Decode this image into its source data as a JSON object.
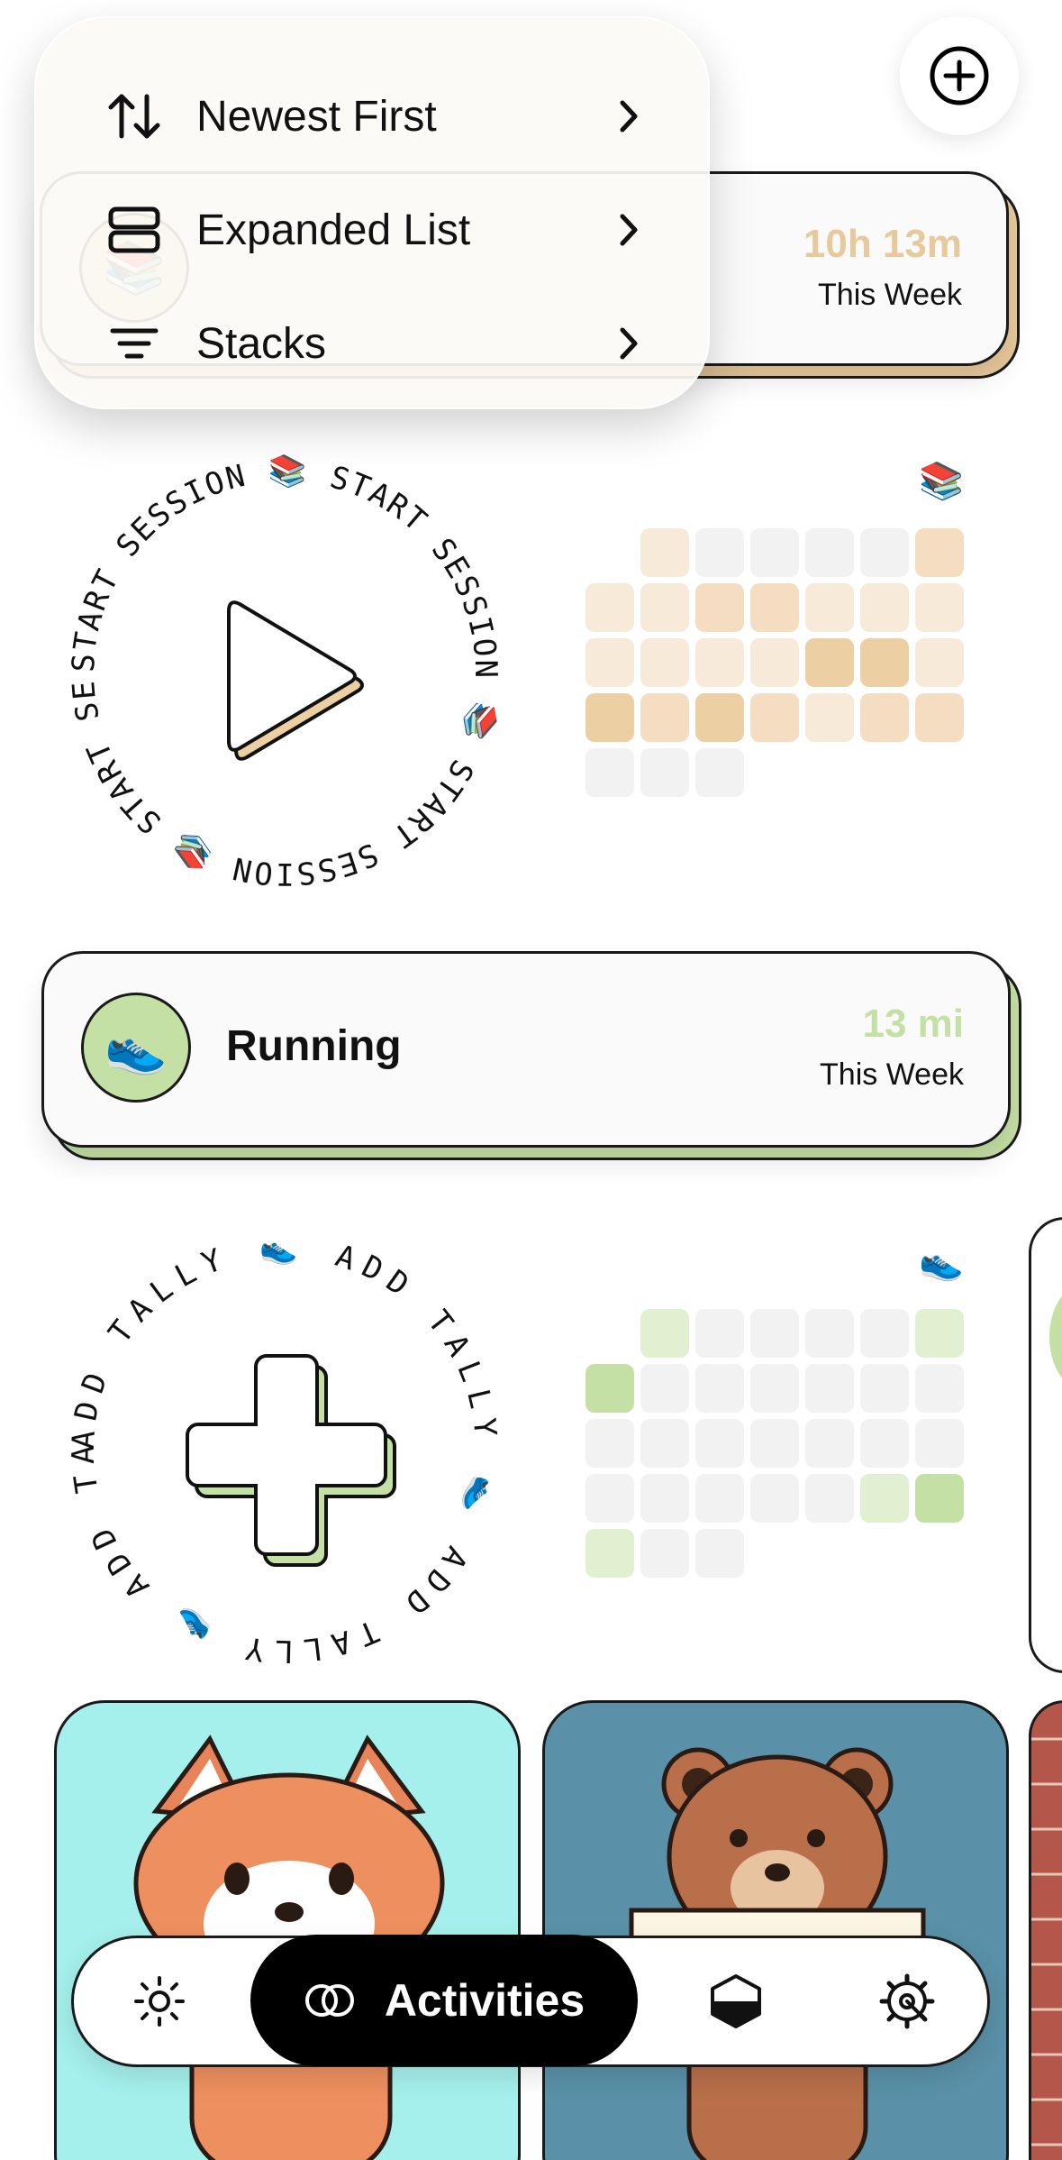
{
  "menu": {
    "items": [
      {
        "label": "Newest First",
        "icon": "sort-arrows-icon"
      },
      {
        "label": "Expanded List",
        "icon": "expanded-list-icon"
      },
      {
        "label": "Stacks",
        "icon": "stacks-icon"
      }
    ]
  },
  "reading_card": {
    "stat": "10h 13m",
    "period": "This Week",
    "icon": "books-icon",
    "accent": "#e8c99b"
  },
  "reading_action": {
    "ring_text": "START SESSION 📚 START SESSION 📚 START SESSION 📚 START SESSION 📚",
    "icon": "play-icon"
  },
  "reading_heatmap": {
    "icon": "books-icon",
    "levels": [
      [
        null,
        1,
        0,
        0,
        0,
        0,
        2
      ],
      [
        1,
        1,
        2,
        2,
        1,
        1,
        1
      ],
      [
        1,
        1,
        1,
        1,
        3,
        3,
        1
      ],
      [
        3,
        2,
        3,
        2,
        1,
        2,
        2
      ],
      [
        0,
        0,
        0,
        null,
        null,
        null,
        null
      ]
    ],
    "colors": [
      "#f2f2f2",
      "#f7ead9",
      "#f4ddc0",
      "#ecd0a3"
    ]
  },
  "running_card": {
    "name": "Running",
    "stat": "13 mi",
    "period": "This Week",
    "icon": "sneaker-icon",
    "accent": "#c5e0a5"
  },
  "running_action": {
    "ring_text": "ADD TALLY 👟 ADD TALLY 👟 ADD TALLY 👟 ADD TALLY 👟",
    "icon": "plus-icon"
  },
  "running_heatmap": {
    "icon": "sneaker-icon",
    "levels": [
      [
        null,
        1,
        0,
        0,
        0,
        0,
        1
      ],
      [
        2,
        0,
        0,
        0,
        0,
        0,
        0
      ],
      [
        0,
        0,
        0,
        0,
        0,
        0,
        0
      ],
      [
        0,
        0,
        0,
        0,
        0,
        1,
        2
      ],
      [
        1,
        0,
        0,
        null,
        null,
        null,
        null
      ]
    ],
    "colors": [
      "#f2f2f2",
      "#e1f0d0",
      "#c5e0a5"
    ]
  },
  "tiles": [
    {
      "name": "fox",
      "bg": "#a5f0ec"
    },
    {
      "name": "bear",
      "bg": "#5a91a8"
    },
    {
      "name": "brick",
      "bg": "#b5564a"
    }
  ],
  "tabbar": {
    "active_label": "Activities",
    "tabs": [
      "sun-icon",
      "activities-icon",
      "hexagon-icon",
      "gear-icon"
    ]
  }
}
